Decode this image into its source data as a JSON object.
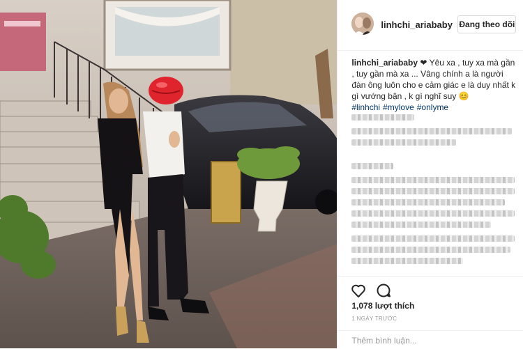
{
  "post": {
    "username": "linhchi_aria​baby",
    "follow_button_label": "Đang theo dõi",
    "caption": {
      "username": "linhchi_aria​baby",
      "heart": "❤",
      "text": " Yêu xa , tuy xa mà gần , tuy gần mà xa ... Vâng chính a là người đàn ông luôn cho e cảm giác e là duy nhất k gì vướng bận , k gì nghĩ suy ",
      "emoji": "😊",
      "hashtags": [
        "#linhchi",
        "#mylove",
        "#onlyme"
      ]
    },
    "likes_text": "1,078 lượt thích",
    "timestamp": "1 NGÀY TRƯỚC",
    "comment_placeholder": "Thêm bình luận..."
  },
  "icons": {
    "like": "heart-outline-icon",
    "comment": "speech-bubble-icon",
    "avatar": "profile-avatar"
  },
  "colors": {
    "hashtag": "#003569",
    "border": "#efefef",
    "muted_text": "#999999",
    "face_sticker": "#e0242e"
  }
}
